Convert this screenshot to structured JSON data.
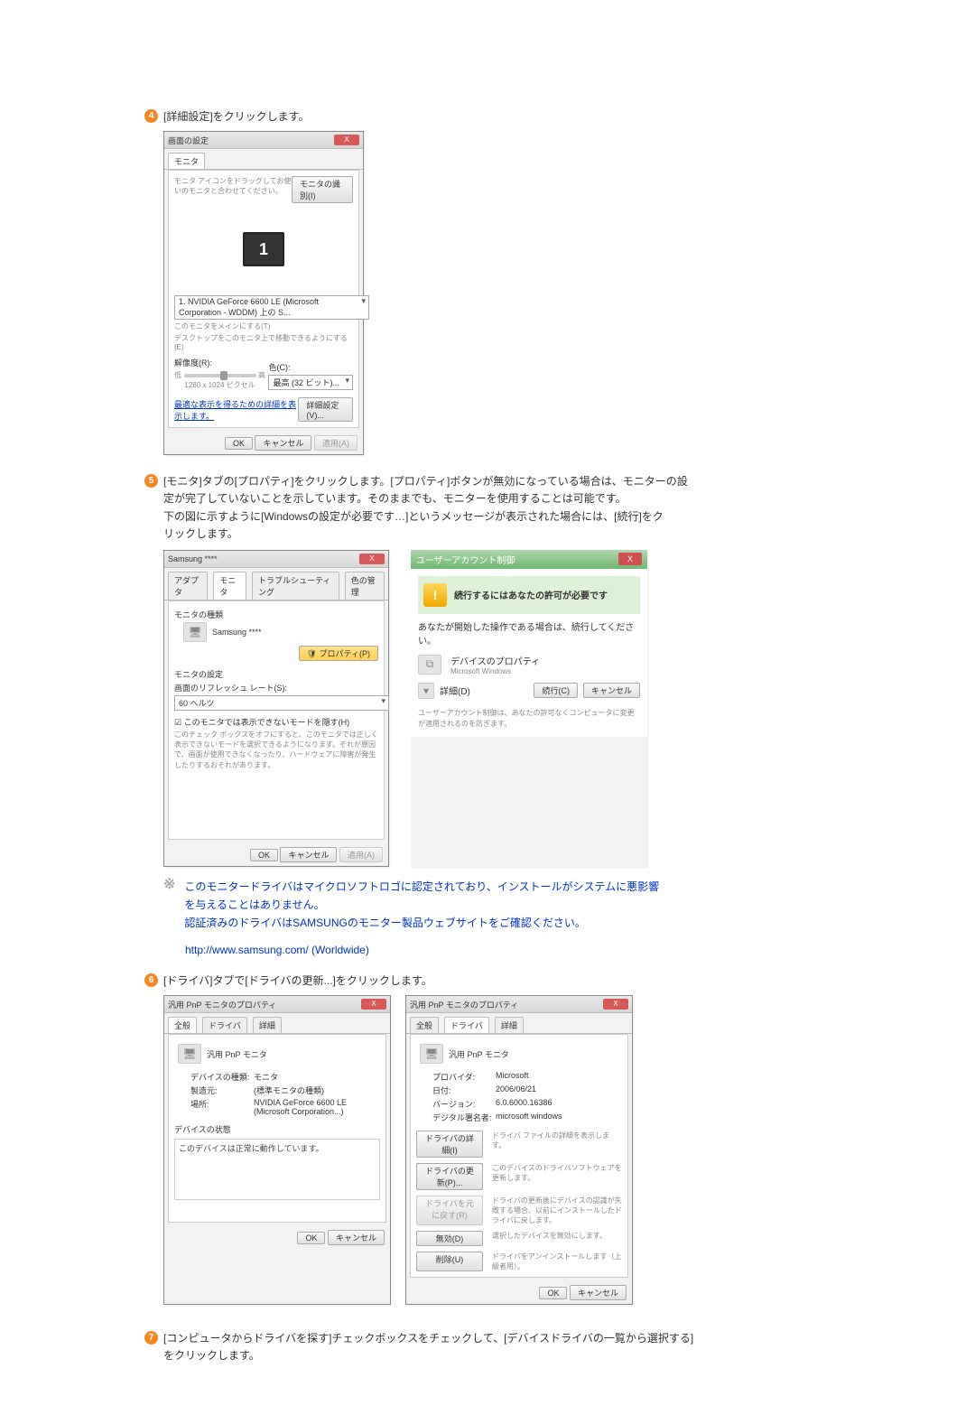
{
  "steps": {
    "s4": {
      "num": "4",
      "text": "[詳細設定]をクリックします。"
    },
    "s5": {
      "num": "5",
      "l1": "[モニタ]タブの[プロパティ]をクリックします。[プロパティ]ボタンが無効になっている場合は、モニターの設",
      "l2": "定が完了していないことを示しています。そのままでも、モニターを使用することは可能です。",
      "l3": "下の図に示すように[Windowsの設定が必要です…]というメッセージが表示された場合には、[続行]をク",
      "l4": "リックします。"
    },
    "s6": {
      "num": "6",
      "text": "[ドライバ]タブで[ドライバの更新...]をクリックします。"
    },
    "s7": {
      "num": "7",
      "l1": "[コンピュータからドライバを探す]チェックボックスをチェックして、[デバイスドライバの一覧から選択する]",
      "l2": "をクリックします。"
    }
  },
  "note": {
    "mark": "※",
    "l1": "このモニタードライバはマイクロソフトロゴに認定されており、インストールがシステムに悪影響",
    "l2": "を与えることはありません。",
    "l3": "認証済みのドライバはSAMSUNGのモニター製品ウェブサイトをご確認ください。"
  },
  "links": {
    "samsung": "http://www.samsung.com/ (Worldwide)"
  },
  "ss1": {
    "title": "画面の設定",
    "tab": "モニタ",
    "desc": "モニタ アイコンをドラッグしてお使いのモニタと合わせてください。",
    "btn_identify": "モニタの識別(I)",
    "monitor_num": "1",
    "gpu_line": "1. NVIDIA GeForce 6600 LE (Microsoft Corporation - WDDM) 上の S...",
    "chk1": "このモニタをメインにする(T)",
    "chk2": "デスクトップをこのモニタ上で移動できるようにする(E)",
    "res_label": "解像度(R):",
    "res_val": "1280 x 1024 ピクセル",
    "res_low": "低",
    "res_high": "高",
    "color_label": "色(C):",
    "color_val": "最高 (32 ビット)...",
    "help_link": "最適な表示を得るための詳細を表示します。",
    "btn_adv": "詳細設定(V)...",
    "ok": "OK",
    "cancel": "キャンセル",
    "apply": "適用(A)"
  },
  "ss5a": {
    "title": "Samsung ****",
    "tabs": {
      "adapter": "アダプタ",
      "monitor": "モニタ",
      "trouble": "トラブルシューティング",
      "color": "色の管理"
    },
    "grp_type": "モニタの種類",
    "name": "Samsung ****",
    "btn_prop": "プロパティ(P)",
    "grp_set": "モニタの設定",
    "refresh_label": "画面のリフレッシュ レート(S):",
    "refresh_val": "60 ヘルツ",
    "chk_hide": "このモニタでは表示できないモードを隠す(H)",
    "warn": "このチェック ボックスをオフにすると、このモニタでは正しく表示できないモードを選択できるようになります。それが原因で、画面が使用できなくなったり、ハードウェアに障害が発生したりするおそれがあります。",
    "ok": "OK",
    "cancel": "キャンセル",
    "apply": "適用(A)"
  },
  "ss5b": {
    "title": "ユーザーアカウント制御",
    "prompt": "続行するにはあなたの許可が必要です",
    "subtitle": "あなたが開始した操作である場合は、続行してください。",
    "device": "デバイスのプロパティ",
    "publisher": "Microsoft Windows",
    "details": "詳細(D)",
    "continue": "続行(C)",
    "cancel": "キャンセル",
    "foot": "ユーザーアカウント制御は、あなたの許可なくコンピュータに変更が適用されるのを防ぎます。"
  },
  "ss6a": {
    "title": "汎用 PnP モニタのプロパティ",
    "tabs": {
      "general": "全般",
      "driver": "ドライバ",
      "detail": "詳細"
    },
    "name": "汎用 PnP モニタ",
    "k_type": "デバイスの種類:",
    "v_type": "モニタ",
    "k_mfg": "製造元:",
    "v_mfg": "(標準モニタの種類)",
    "k_loc": "場所:",
    "v_loc": "NVIDIA GeForce 6600 LE (Microsoft Corporation...)",
    "grp_status": "デバイスの状態",
    "status_text": "このデバイスは正常に動作しています。",
    "ok": "OK",
    "cancel": "キャンセル"
  },
  "ss6b": {
    "title": "汎用 PnP モニタのプロパティ",
    "tabs": {
      "general": "全般",
      "driver": "ドライバ",
      "detail": "詳細"
    },
    "name": "汎用 PnP モニタ",
    "k_prov": "プロバイダ:",
    "v_prov": "Microsoft",
    "k_date": "日付:",
    "v_date": "2006/06/21",
    "k_ver": "バージョン:",
    "v_ver": "6.0.6000.16386",
    "k_sign": "デジタル署名者:",
    "v_sign": "microsoft windows",
    "b_details": "ドライバの詳細(I)",
    "d_details": "ドライバ ファイルの詳細を表示します。",
    "b_update": "ドライバの更新(P)...",
    "d_update": "このデバイスのドライバソフトウェアを更新します。",
    "b_rollback": "ドライバを元に戻す(R)",
    "d_rollback": "ドライバの更新後にデバイスの認識が失敗する場合、以前にインストールしたドライバに戻します。",
    "b_disable": "無効(D)",
    "d_disable": "選択したデバイスを無効にします。",
    "b_uninstall": "削除(U)",
    "d_uninstall": "ドライバをアンインストールします（上級者用）。",
    "ok": "OK",
    "cancel": "キャンセル"
  }
}
